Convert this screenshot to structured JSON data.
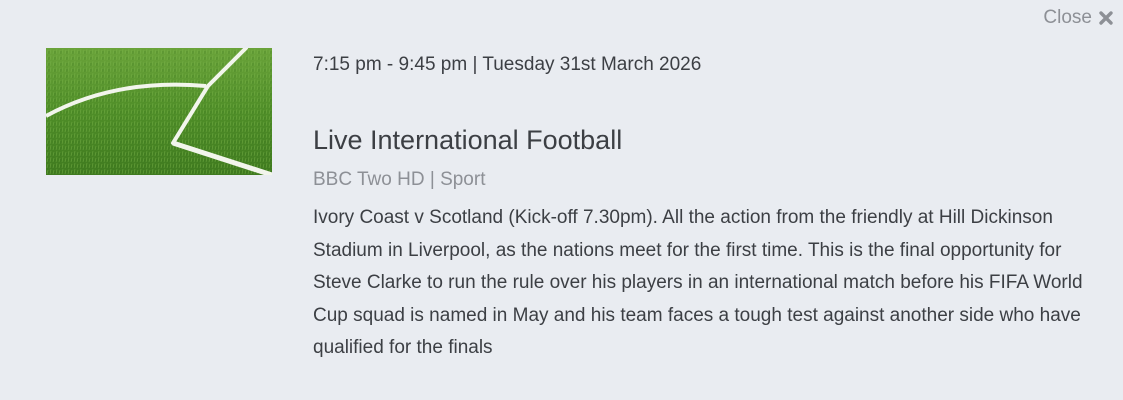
{
  "close": {
    "label": "Close",
    "icon": "close-icon"
  },
  "programme": {
    "time": "7:15 pm - 9:45 pm | Tuesday 31st March 2026",
    "title": "Live International Football",
    "channel": "BBC Two HD",
    "genre": "Sport",
    "meta": "BBC Two HD | Sport",
    "description": "Ivory Coast v Scotland (Kick-off 7.30pm). All the action from the friendly at Hill Dickinson Stadium in Liverpool, as the nations meet for the first time. This is the final opportunity for Steve Clarke to run the rule over his players in an international match before his FIFA World Cup squad is named in May and his team faces a tough test against another side who have qualified for the finals"
  },
  "colors": {
    "background": "#e9ecf1",
    "text": "#3c3f44",
    "muted": "#8d9096",
    "grass": "#4e8a2a"
  }
}
